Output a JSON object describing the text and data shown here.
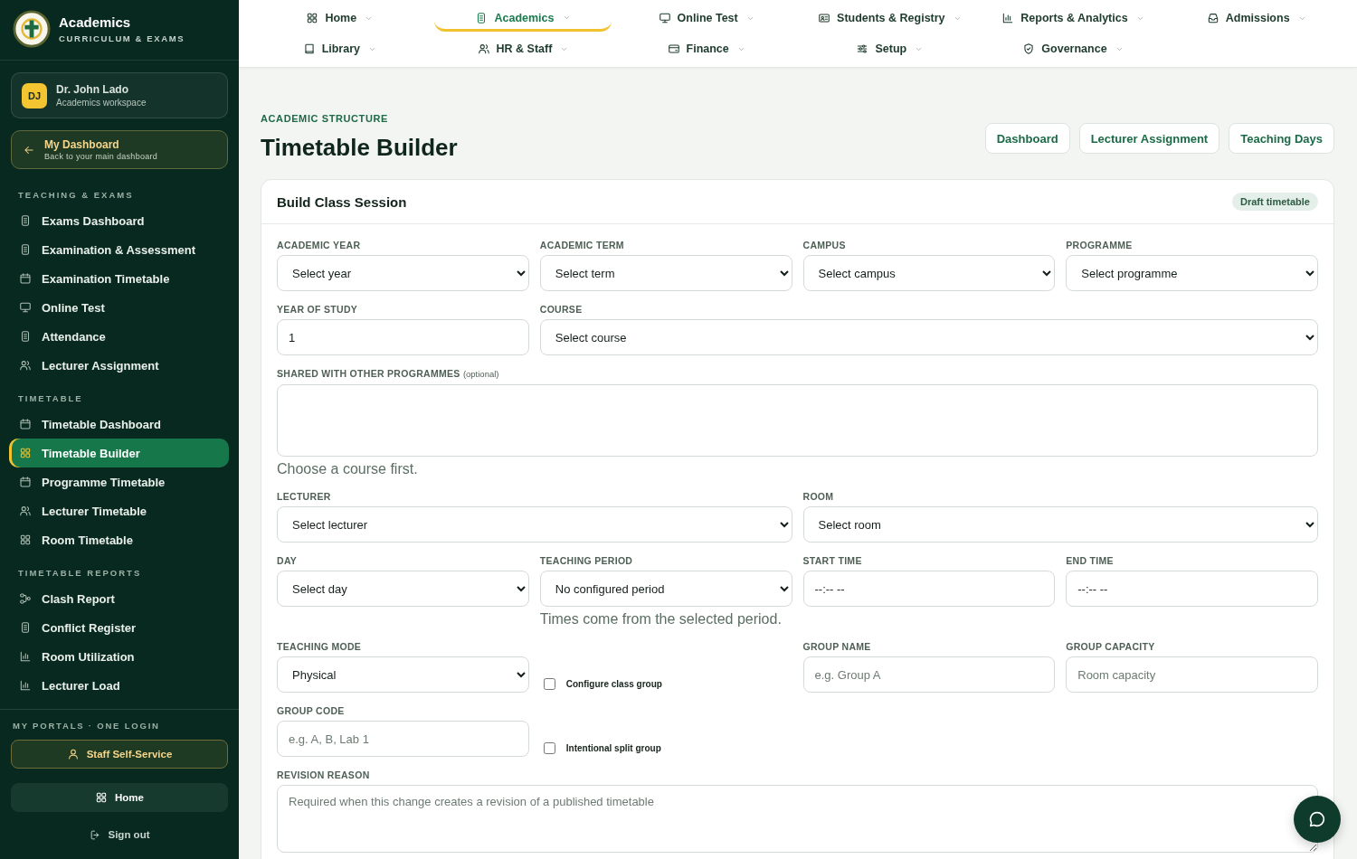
{
  "sidebar": {
    "brand": {
      "title": "Academics",
      "subtitle": "CURRICULUM & EXAMS"
    },
    "user": {
      "initials": "DJ",
      "name": "Dr. John Lado",
      "role": "Academics workspace"
    },
    "back_link": {
      "title": "My Dashboard",
      "subtitle": "Back to your main dashboard"
    },
    "sections": [
      {
        "heading": "TEACHING & EXAMS",
        "items": [
          {
            "label": "Exams Dashboard",
            "kind": "clipboard",
            "selected": false
          },
          {
            "label": "Examination & Assessment",
            "kind": "clipboard",
            "selected": false
          },
          {
            "label": "Examination Timetable",
            "kind": "calendar",
            "selected": false
          },
          {
            "label": "Online Test",
            "kind": "monitor",
            "selected": false
          },
          {
            "label": "Attendance",
            "kind": "clipboard",
            "selected": false
          },
          {
            "label": "Lecturer Assignment",
            "kind": "users",
            "selected": false
          }
        ]
      },
      {
        "heading": "TIMETABLE",
        "items": [
          {
            "label": "Timetable Dashboard",
            "kind": "calendar",
            "selected": false
          },
          {
            "label": "Timetable Builder",
            "kind": "grid",
            "selected": true
          },
          {
            "label": "Programme Timetable",
            "kind": "calendar",
            "selected": false
          },
          {
            "label": "Lecturer Timetable",
            "kind": "users",
            "selected": false
          },
          {
            "label": "Room Timetable",
            "kind": "grid",
            "selected": false
          }
        ]
      },
      {
        "heading": "TIMETABLE REPORTS",
        "items": [
          {
            "label": "Clash Report",
            "kind": "flow",
            "selected": false
          },
          {
            "label": "Conflict Register",
            "kind": "clipboard",
            "selected": false
          },
          {
            "label": "Room Utilization",
            "kind": "chart",
            "selected": false
          },
          {
            "label": "Lecturer Load",
            "kind": "chart",
            "selected": false
          }
        ]
      }
    ],
    "portals": {
      "heading": "MY PORTALS · ONE LOGIN",
      "buttons": [
        {
          "label": "Staff Self-Service",
          "kind": "portal"
        },
        {
          "label": "Home",
          "kind": "home"
        }
      ]
    },
    "sign_out": "Sign out"
  },
  "top_nav": {
    "rows": [
      [
        {
          "label": "Home",
          "kind": "grid",
          "selected": false
        },
        {
          "label": "Academics",
          "kind": "clipboard",
          "selected": true
        },
        {
          "label": "Online Test",
          "kind": "monitor",
          "selected": false
        },
        {
          "label": "Students & Registry",
          "kind": "idcard",
          "selected": false
        },
        {
          "label": "Reports & Analytics",
          "kind": "chart",
          "selected": false
        },
        {
          "label": "Admissions",
          "kind": "inbox",
          "selected": false
        }
      ],
      [
        {
          "label": "Library",
          "kind": "book",
          "selected": false
        },
        {
          "label": "HR & Staff",
          "kind": "users",
          "selected": false
        },
        {
          "label": "Finance",
          "kind": "wallet",
          "selected": false
        },
        {
          "label": "Setup",
          "kind": "sliders",
          "selected": false
        },
        {
          "label": "Governance",
          "kind": "shield",
          "selected": false
        }
      ]
    ]
  },
  "header": {
    "eyebrow": "ACADEMIC STRUCTURE",
    "title": "Timetable Builder",
    "actions": [
      "Dashboard",
      "Lecturer Assignment",
      "Teaching Days"
    ]
  },
  "card": {
    "title": "Build Class Session",
    "badge": "Draft timetable",
    "fields": [
      {
        "kind": "select",
        "label": "ACADEMIC YEAR",
        "value": "Select year"
      },
      {
        "kind": "select",
        "label": "ACADEMIC TERM",
        "value": "Select term"
      },
      {
        "kind": "select",
        "label": "CAMPUS",
        "value": "Select campus"
      },
      {
        "kind": "select",
        "label": "PROGRAMME",
        "value": "Select programme"
      },
      {
        "kind": "input",
        "label": "YEAR OF STUDY",
        "value": "1"
      },
      {
        "kind": "select",
        "label": "COURSE",
        "value": "Select course"
      },
      {
        "kind": "multiselect",
        "label": "SHARED WITH OTHER PROGRAMMES",
        "note": "(optional)",
        "hint": "Choose a course first."
      },
      {
        "kind": "select",
        "label": "LECTURER",
        "value": "Select lecturer"
      },
      {
        "kind": "select",
        "label": "ROOM",
        "value": "Select room"
      },
      {
        "kind": "select",
        "label": "DAY",
        "value": "Select day"
      },
      {
        "kind": "select",
        "label": "TEACHING PERIOD",
        "value": "No configured period",
        "hint": "Times come from the selected period."
      },
      {
        "kind": "time",
        "label": "START TIME",
        "placeholder": "--:-- --"
      },
      {
        "kind": "time",
        "label": "END TIME",
        "placeholder": "--:-- --"
      },
      {
        "kind": "select",
        "label": "TEACHING MODE",
        "value": "Physical"
      },
      {
        "kind": "checkbox",
        "label": "Configure class group",
        "checked": false
      },
      {
        "kind": "input",
        "label": "GROUP NAME",
        "placeholder": "e.g. Group A"
      },
      {
        "kind": "input",
        "label": "GROUP CAPACITY",
        "placeholder": "Room capacity"
      },
      {
        "kind": "input",
        "label": "GROUP CODE",
        "placeholder": "e.g. A, B, Lab 1"
      },
      {
        "kind": "checkbox",
        "label": "Intentional split group",
        "checked": false
      },
      {
        "kind": "textarea",
        "label": "REVISION REASON",
        "placeholder": "Required when this change creates a revision of a published timetable"
      }
    ]
  }
}
